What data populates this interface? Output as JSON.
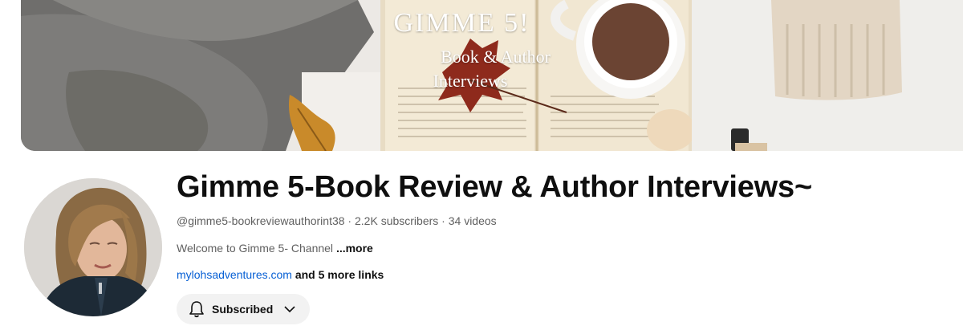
{
  "banner": {
    "title": "GIMME 5!",
    "subtitle_line1": "Book & Author",
    "subtitle_line2": "Interviews"
  },
  "channel": {
    "name": "Gimme 5-Book Review & Author Interviews~",
    "handle": "@gimme5-bookreviewauthorint38",
    "separator": " · ",
    "subscribers": "2.2K subscribers",
    "videos": "34 videos",
    "description": "Welcome to Gimme 5- Channel ",
    "description_more": "...more",
    "link_text": "mylohsadventures.com",
    "more_links": " and 5 more links"
  },
  "subscribe_button": {
    "label": "Subscribed",
    "icon": "bell-icon",
    "chevron": "chevron-down-icon"
  }
}
